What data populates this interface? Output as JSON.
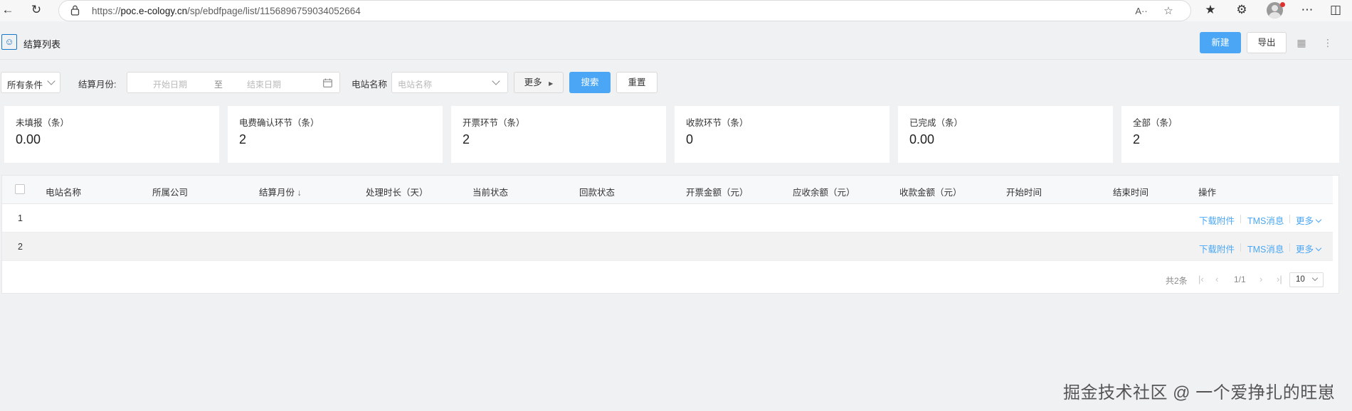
{
  "browser": {
    "url_domain": "poc.e-cology.cn",
    "url_prefix": "https://",
    "url_path": "/sp/ebdfpage/list/1156896759034052664",
    "read_aloud": "A··"
  },
  "header": {
    "title": "结算列表",
    "new_label": "新建",
    "export_label": "导出"
  },
  "filters": {
    "condition_select": "所有条件",
    "settlement_month_label": "结算月份:",
    "start_placeholder": "开始日期",
    "range_to": "至",
    "end_placeholder": "结束日期",
    "station_label": "电站名称",
    "station_placeholder": "电站名称",
    "more_label": "更多",
    "search_label": "搜索",
    "reset_label": "重置"
  },
  "stats": [
    {
      "title": "未填报（条）",
      "value": "0.00"
    },
    {
      "title": "电费确认环节（条）",
      "value": "2"
    },
    {
      "title": "开票环节（条）",
      "value": "2"
    },
    {
      "title": "收款环节（条）",
      "value": "0"
    },
    {
      "title": "已完成（条）",
      "value": "0.00"
    },
    {
      "title": "全部（条）",
      "value": "2"
    }
  ],
  "table": {
    "columns": [
      "电站名称",
      "所属公司",
      "结算月份",
      "处理时长（天）",
      "当前状态",
      "回款状态",
      "开票金额（元）",
      "应收余额（元）",
      "收款金额（元）",
      "开始时间",
      "结束时间",
      "操作"
    ],
    "sort_indicator": "↓",
    "rows": [
      {
        "index": "1",
        "actions": [
          "下载附件",
          "TMS消息",
          "更多"
        ]
      },
      {
        "index": "2",
        "actions": [
          "下载附件",
          "TMS消息",
          "更多"
        ]
      }
    ]
  },
  "pagination": {
    "total": "共2条",
    "page": "1/1",
    "page_size": "10"
  },
  "watermark": "掘金技术社区 @ 一个爱挣扎的旺崽",
  "colors": {
    "primary": "#4ba7f5",
    "link": "#4ba7f5",
    "background": "#f0f1f3"
  }
}
